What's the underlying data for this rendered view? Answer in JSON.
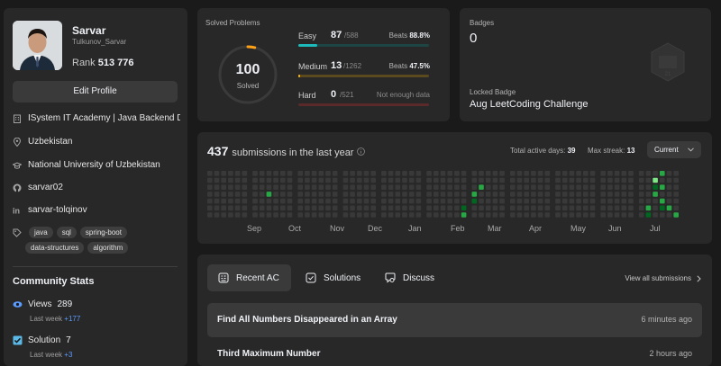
{
  "profile": {
    "name": "Sarvar",
    "username": "Tulkunov_Sarvar",
    "rank_label": "Rank",
    "rank_value": "513 776",
    "edit_label": "Edit Profile",
    "info": [
      {
        "icon": "building-icon",
        "text": "ISystem IT Academy | Java Backend D..."
      },
      {
        "icon": "location-icon",
        "text": "Uzbekistan"
      },
      {
        "icon": "graduation-cap-icon",
        "text": "National University of Uzbekistan"
      },
      {
        "icon": "github-icon",
        "text": "sarvar02"
      },
      {
        "icon": "linkedin-icon",
        "text": "sarvar-tolqinov"
      }
    ],
    "tags_row1": [
      "java",
      "sql",
      "spring-boot"
    ],
    "tags_row2": [
      "data-structures",
      "algorithm"
    ]
  },
  "community": {
    "title": "Community Stats",
    "views": {
      "label": "Views",
      "value": "289",
      "sub_label": "Last week",
      "sub_value": "+177"
    },
    "solution": {
      "label": "Solution",
      "value": "7",
      "sub_label": "Last week",
      "sub_value": "+3"
    }
  },
  "solved": {
    "title": "Solved Problems",
    "total": "100",
    "total_label": "Solved",
    "progress_fraction": 0.04,
    "easy": {
      "label": "Easy",
      "count": "87",
      "total": "/588",
      "beats_label": "Beats",
      "beats": "88.8%",
      "fraction": 0.148
    },
    "medium": {
      "label": "Medium",
      "count": "13",
      "total": "/1262",
      "beats_label": "Beats",
      "beats": "47.5%",
      "fraction": 0.0103
    },
    "hard": {
      "label": "Hard",
      "count": "0",
      "total": "/521",
      "note": "Not enough data",
      "fraction": 0
    }
  },
  "badges": {
    "title": "Badges",
    "count": "0",
    "locked_label": "Locked Badge",
    "locked_name": "Aug LeetCoding Challenge"
  },
  "submissions": {
    "count": "437",
    "label": "submissions in the last year",
    "active_label": "Total active days:",
    "active_value": "39",
    "streak_label": "Max streak:",
    "streak_value": "13",
    "dropdown": "Current",
    "months": [
      "Sep",
      "Oct",
      "Nov",
      "Dec",
      "Jan",
      "Feb",
      "Mar",
      "Apr",
      "May",
      "Jun",
      "Jul"
    ]
  },
  "recent": {
    "tabs": [
      {
        "icon": "recent-ac-icon",
        "label": "Recent AC"
      },
      {
        "icon": "solutions-icon",
        "label": "Solutions"
      },
      {
        "icon": "discuss-icon",
        "label": "Discuss"
      }
    ],
    "view_all": "View all submissions",
    "items": [
      {
        "title": "Find All Numbers Disappeared in an Array",
        "time": "6 minutes ago"
      },
      {
        "title": "Third Maximum Number",
        "time": "2 hours ago"
      }
    ]
  },
  "colors": {
    "easy": "#1cbaba",
    "medium": "#ffb700",
    "hard": "#f63737",
    "accent": "#5c9bff",
    "heat_empty": "#393939",
    "heat_low": "#016620",
    "heat_mid": "#28a745",
    "heat_high": "#7ee787"
  }
}
